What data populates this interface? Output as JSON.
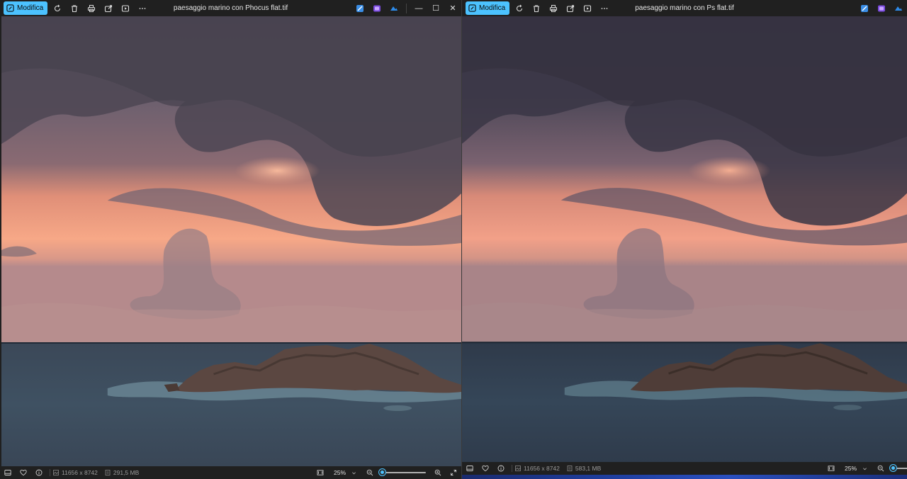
{
  "windows": [
    {
      "edit_label": "Modifica",
      "title": "paesaggio marino con Phocus flat.tif",
      "dimensions": "11656 x 8742",
      "file_size": "291,5 MB",
      "zoom": "25%",
      "zoom_fraction": 0.0,
      "window_controls": {
        "minimize": "—",
        "maximize": "☐",
        "close": "✕"
      }
    },
    {
      "edit_label": "Modifica",
      "title": "paesaggio marino con  Ps flat.tif",
      "dimensions": "11656 x 8742",
      "file_size": "583,1 MB",
      "zoom": "25%",
      "zoom_fraction": 0.0
    }
  ],
  "icons": {
    "edit": "edit-icon",
    "rotate": "rotate-icon",
    "delete": "delete-icon",
    "print": "print-icon",
    "share": "share-icon",
    "slideshow": "slideshow-icon",
    "more": "more-icon",
    "zoom_out": "zoom-out-icon",
    "zoom_in": "zoom-in-icon"
  },
  "colors": {
    "accent": "#4cc2ff",
    "window_bg": "#202020"
  }
}
